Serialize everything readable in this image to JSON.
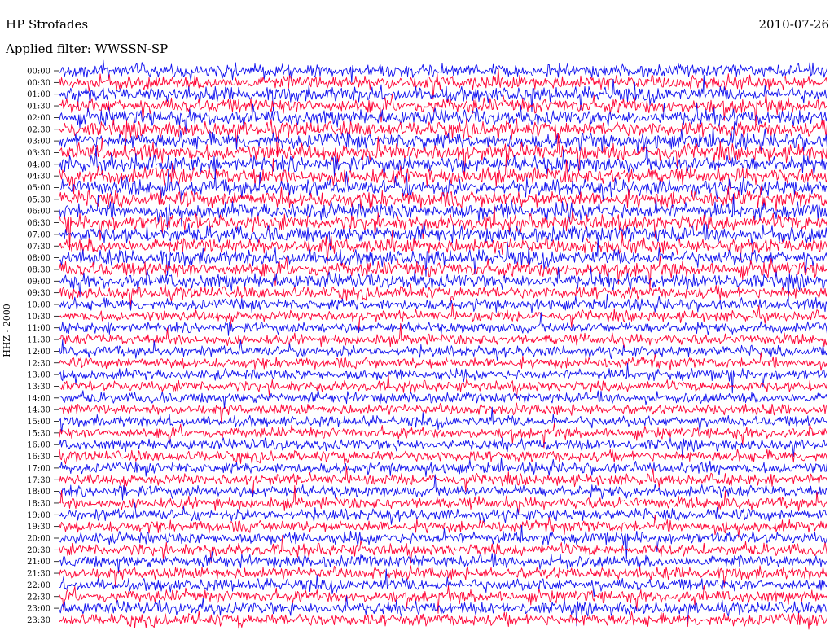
{
  "header": {
    "title": "HP Strofades",
    "date": "2010-07-26",
    "filter": "Applied filter: WWSSN-SP"
  },
  "colors": {
    "blue": "#1010ee",
    "red": "#ff0033",
    "background": "#ffffff"
  },
  "chart_data": {
    "type": "line",
    "title": "HP Strofades",
    "ylabel": "HHZ - 2000",
    "row_labels": [
      "00:00",
      "00:30",
      "01:00",
      "01:30",
      "02:00",
      "02:30",
      "03:00",
      "03:30",
      "04:00",
      "04:30",
      "05:00",
      "05:30",
      "06:00",
      "06:30",
      "07:00",
      "07:30",
      "08:00",
      "08:30",
      "09:00",
      "09:30",
      "10:00",
      "10:30",
      "11:00",
      "11:30",
      "12:00",
      "12:30",
      "13:00",
      "13:30",
      "14:00",
      "14:30",
      "15:00",
      "15:30",
      "16:00",
      "16:30",
      "17:00",
      "17:30",
      "18:00",
      "18:30",
      "19:00",
      "19:30",
      "20:00",
      "20:30",
      "21:00",
      "21:30",
      "22:00",
      "22:30",
      "23:00",
      "23:30"
    ],
    "series_colors": [
      "blue",
      "red"
    ],
    "noise_level": [
      0.6,
      0.75,
      0.8,
      0.85,
      0.85,
      0.9,
      0.95,
      1,
      1,
      1,
      1,
      1,
      1,
      0.95,
      0.95,
      0.9,
      0.9,
      0.85,
      0.8,
      0.6,
      0.45,
      0.4,
      0.4,
      0.4,
      0.4,
      0.4,
      0.4,
      0.4,
      0.4,
      0.4,
      0.4,
      0.4,
      0.4,
      0.45,
      0.45,
      0.45,
      0.5,
      0.5,
      0.5,
      0.5,
      0.55,
      0.55,
      0.55,
      0.55,
      0.55,
      0.55,
      0.6,
      0.6
    ]
  }
}
